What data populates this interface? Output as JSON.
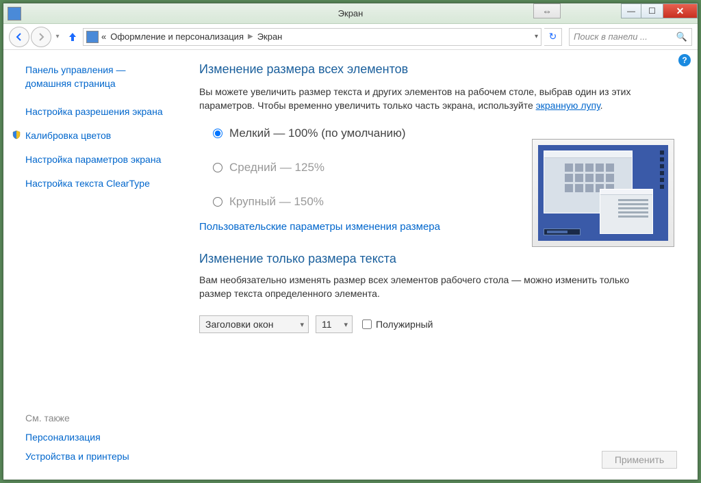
{
  "titlebar": {
    "title": "Экран"
  },
  "nav": {
    "breadcrumb_prefix": "«",
    "breadcrumb1": "Оформление и персонализация",
    "breadcrumb2": "Экран",
    "search_placeholder": "Поиск в панели ..."
  },
  "sidebar": {
    "home1": "Панель управления —",
    "home2": "домашняя страница",
    "links": [
      "Настройка разрешения экрана",
      "Калибровка цветов",
      "Настройка параметров экрана",
      "Настройка текста ClearType"
    ]
  },
  "seealso": {
    "header": "См. также",
    "links": [
      "Персонализация",
      "Устройства и принтеры"
    ]
  },
  "main": {
    "h1": "Изменение размера всех элементов",
    "desc_a": "Вы можете увеличить размер текста и других элементов на рабочем столе, выбрав один из этих параметров. Чтобы временно увеличить только часть экрана, используйте ",
    "desc_link": "экранную лупу",
    "desc_b": ".",
    "radios": [
      "Мелкий — 100% (по умолчанию)",
      "Средний — 125%",
      "Крупный — 150%"
    ],
    "custom_link": "Пользовательские параметры изменения размера",
    "h2": "Изменение только размера текста",
    "desc2": "Вам необязательно изменять размер всех элементов рабочего стола — можно изменить только размер текста определенного элемента.",
    "select_element": "Заголовки окон",
    "select_size": "11",
    "bold_label": "Полужирный",
    "apply": "Применить"
  }
}
